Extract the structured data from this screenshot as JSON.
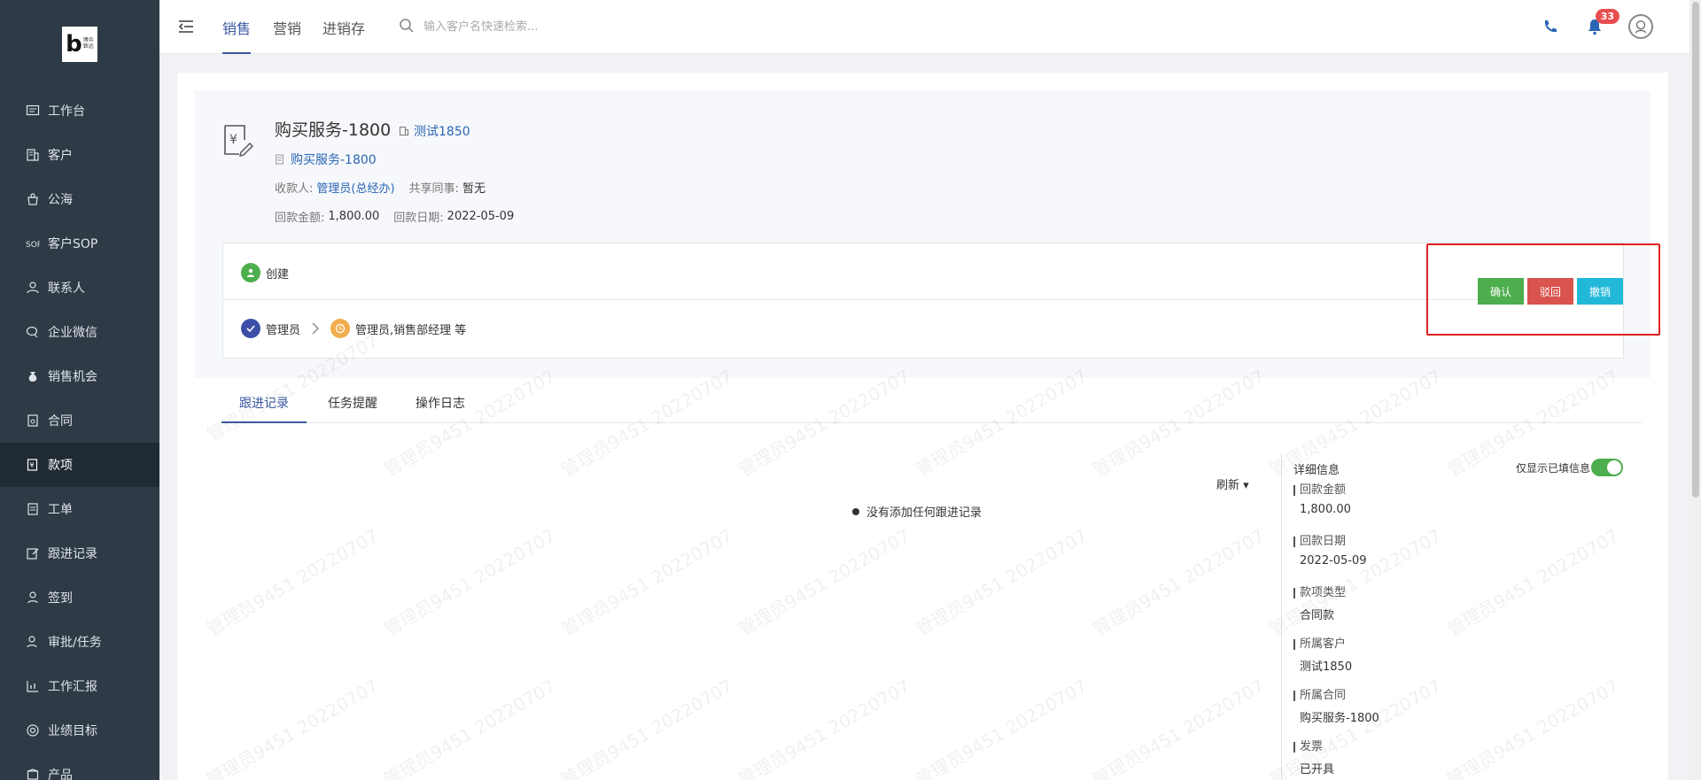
{
  "sidebar": {
    "logo_main": "b",
    "logo_text_line1": "博众",
    "logo_text_line2": "致远",
    "items": [
      {
        "label": "工作台",
        "icon": "workbench-icon"
      },
      {
        "label": "客户",
        "icon": "building-icon"
      },
      {
        "label": "公海",
        "icon": "pool-icon"
      },
      {
        "label": "客户SOP",
        "icon": "sop-icon"
      },
      {
        "label": "联系人",
        "icon": "contact-icon"
      },
      {
        "label": "企业微信",
        "icon": "wechat-icon"
      },
      {
        "label": "销售机会",
        "icon": "moneybag-icon"
      },
      {
        "label": "合同",
        "icon": "contract-icon"
      },
      {
        "label": "款项",
        "icon": "payment-icon",
        "active": true
      },
      {
        "label": "工单",
        "icon": "ticket-icon"
      },
      {
        "label": "跟进记录",
        "icon": "edit-icon"
      },
      {
        "label": "签到",
        "icon": "checkin-icon"
      },
      {
        "label": "审批/任务",
        "icon": "approval-icon"
      },
      {
        "label": "工作汇报",
        "icon": "report-icon"
      },
      {
        "label": "业绩目标",
        "icon": "target-icon"
      },
      {
        "label": "产品",
        "icon": "product-icon"
      }
    ]
  },
  "topbar": {
    "tabs": [
      "销售",
      "营销",
      "进销存"
    ],
    "active_tab": "销售",
    "search_placeholder": "输入客户名快速检索...",
    "notification_count": "33"
  },
  "record": {
    "title": "购买服务-1800",
    "customer_link": "测试1850",
    "contract_link": "购买服务-1800",
    "payee_label": "收款人:",
    "payee_value": "管理员(总经办)",
    "shared_label": "共享同事:",
    "shared_value": "暂无",
    "amount_label": "回款金额:",
    "amount_value": "1,800.00",
    "date_label": "回款日期:",
    "date_value": "2022-05-09"
  },
  "flow": {
    "create_label": "创建",
    "step1_label": "管理员",
    "step2_label": "管理员,销售部经理 等"
  },
  "actions": {
    "confirm": "确认",
    "reject": "驳回",
    "revoke": "撤销"
  },
  "tabs": [
    "跟进记录",
    "任务提醒",
    "操作日志"
  ],
  "followup": {
    "refresh_label": "刷新 ▾",
    "empty_text": "没有添加任何跟进记录"
  },
  "detail": {
    "title": "详细信息",
    "toggle_label": "仅显示已填信息",
    "fields": [
      {
        "label": "回款金额",
        "value": "1,800.00"
      },
      {
        "label": "回款日期",
        "value": "2022-05-09"
      },
      {
        "label": "款项类型",
        "value": "合同款"
      },
      {
        "label": "所属客户",
        "value": "测试1850"
      },
      {
        "label": "所属合同",
        "value": "购买服务-1800"
      },
      {
        "label": "发票",
        "value": "已开具"
      }
    ]
  },
  "watermark": "管理员9451 20220707"
}
